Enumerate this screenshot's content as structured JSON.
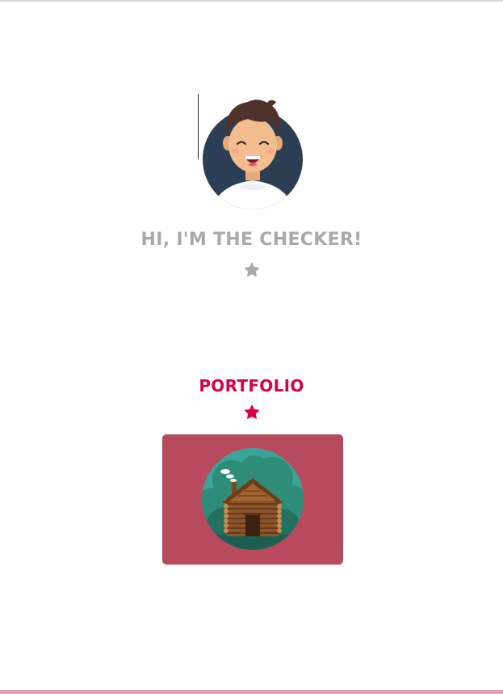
{
  "hero": {
    "title": "HI, I'M THE CHECKER!"
  },
  "portfolio": {
    "title": "PORTFOLIO"
  },
  "icons": {
    "hero_star": "star-icon",
    "portfolio_star": "star-icon",
    "avatar": "avatar-illustration",
    "portfolio_item": "log-cabin-illustration"
  },
  "colors": {
    "hero_text": "#a9a9a9",
    "accent": "#d90047",
    "card_bg": "#b74b5d"
  }
}
